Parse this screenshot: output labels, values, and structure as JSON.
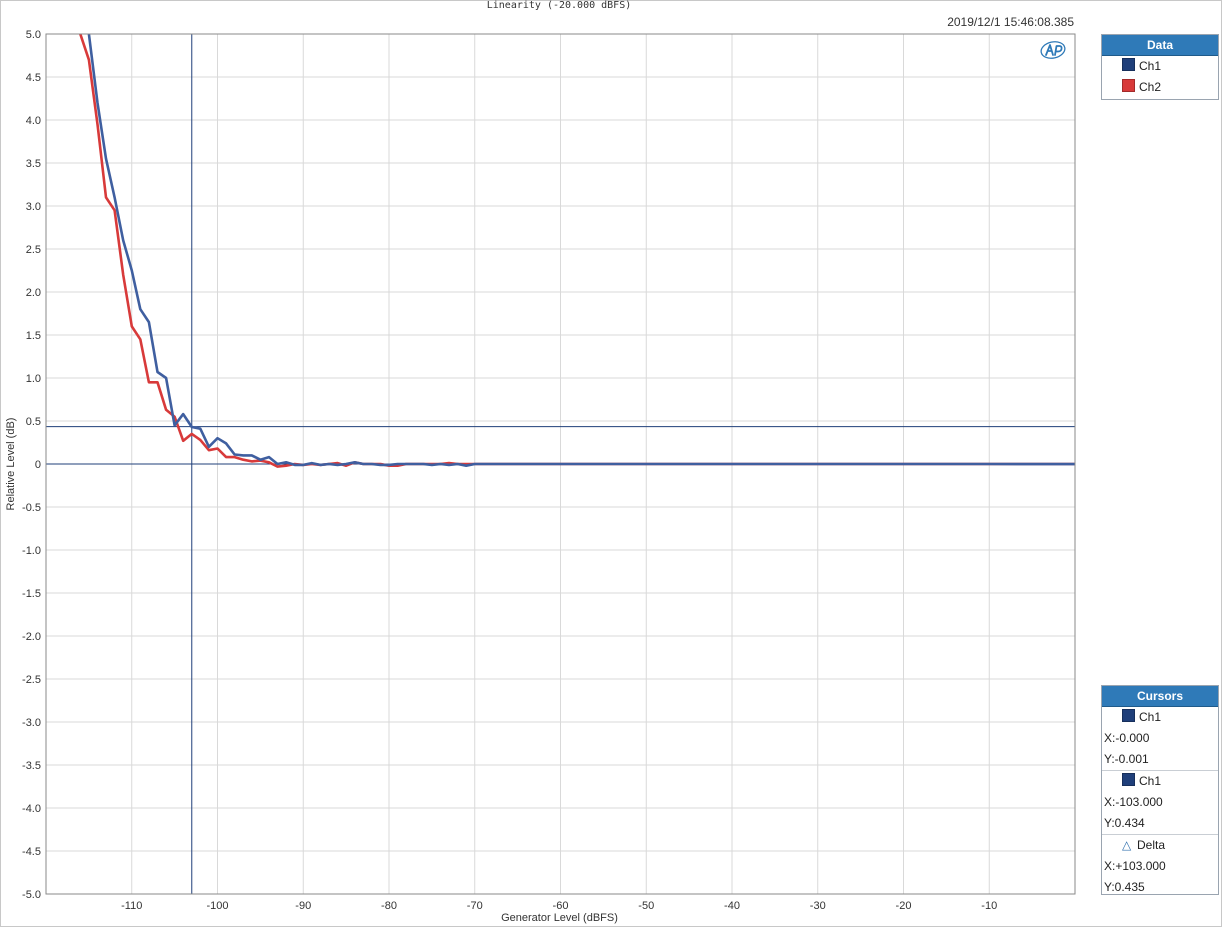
{
  "chart_data": {
    "type": "line",
    "title": "Linearity (-20.000 dBFS)",
    "timestamp": "2019/12/1 15:46:08.385",
    "xlabel": "Generator Level (dBFS)",
    "ylabel": "Relative Level (dB)",
    "xlim": [
      -120,
      0
    ],
    "ylim": [
      -5.0,
      5.0
    ],
    "x_ticks": [
      -110,
      -100,
      -90,
      -80,
      -70,
      -60,
      -50,
      -40,
      -30,
      -20,
      -10
    ],
    "x_tick_labels": [
      "-110",
      "-100",
      "-90",
      "-80",
      "-70",
      "-60",
      "-50",
      "-40",
      "-30",
      "-20",
      "-10"
    ],
    "y_ticks": [
      5.0,
      4.5,
      4.0,
      3.5,
      3.0,
      2.5,
      2.0,
      1.5,
      1.0,
      0.5,
      0,
      -0.5,
      -1.0,
      -1.5,
      -2.0,
      -2.5,
      -3.0,
      -3.5,
      -4.0,
      -4.5,
      -5.0
    ],
    "y_tick_labels": [
      "5.0",
      "4.5",
      "4.0",
      "3.5",
      "3.0",
      "2.5",
      "2.0",
      "1.5",
      "1.0",
      "0.5",
      "0",
      "-0.5",
      "-1.0",
      "-1.5",
      "-2.0",
      "-2.5",
      "-3.0",
      "-3.5",
      "-4.0",
      "-4.5",
      "-5.0"
    ],
    "grid": true,
    "legend_placement": "right",
    "series": [
      {
        "name": "Ch1",
        "color": "#3f5fa0",
        "x": [
          -115,
          -114,
          -113,
          -112,
          -111,
          -110,
          -109,
          -108,
          -107,
          -106,
          -105,
          -104,
          -103,
          -102,
          -101,
          -100,
          -99,
          -98,
          -97,
          -96,
          -95,
          -94,
          -93,
          -92,
          -91,
          -90,
          -89,
          -88,
          -87,
          -86,
          -85,
          -84,
          -83,
          -82,
          -81,
          -80,
          -79,
          -78,
          -77,
          -76,
          -75,
          -74,
          -73,
          -72,
          -71,
          -70,
          -60,
          -50,
          -40,
          -30,
          -20,
          -10,
          0
        ],
        "y": [
          5.0,
          4.2,
          3.55,
          3.1,
          2.6,
          2.25,
          1.8,
          1.65,
          1.07,
          1.0,
          0.45,
          0.58,
          0.43,
          0.41,
          0.2,
          0.3,
          0.24,
          0.11,
          0.1,
          0.1,
          0.05,
          0.08,
          0.0,
          0.02,
          -0.01,
          -0.01,
          0.01,
          -0.01,
          0.0,
          -0.01,
          0.0,
          0.02,
          0.0,
          0.0,
          -0.01,
          -0.01,
          0.0,
          0.0,
          0.0,
          0.0,
          -0.01,
          0.0,
          -0.01,
          0.0,
          -0.02,
          0.0,
          0.0,
          0.0,
          0.0,
          0.0,
          0.0,
          0.0,
          -0.001
        ]
      },
      {
        "name": "Ch2",
        "color": "#d83a3a",
        "x": [
          -116,
          -115,
          -114,
          -113,
          -112,
          -111,
          -110,
          -109,
          -108,
          -107,
          -106,
          -105,
          -104,
          -103,
          -102,
          -101,
          -100,
          -99,
          -98,
          -97,
          -96,
          -95,
          -94,
          -93,
          -92,
          -91,
          -90,
          -89,
          -88,
          -87,
          -86,
          -85,
          -84,
          -83,
          -82,
          -81,
          -80,
          -79,
          -78,
          -77,
          -76,
          -75,
          -74,
          -73,
          -72,
          -71,
          -70,
          -60,
          -50,
          -40,
          -30,
          -20,
          -10,
          0
        ],
        "y": [
          5.0,
          4.7,
          3.95,
          3.1,
          2.95,
          2.2,
          1.6,
          1.45,
          0.95,
          0.95,
          0.63,
          0.55,
          0.27,
          0.35,
          0.28,
          0.16,
          0.18,
          0.08,
          0.08,
          0.05,
          0.03,
          0.04,
          0.02,
          -0.03,
          -0.02,
          0.0,
          -0.01,
          0.0,
          -0.01,
          0.0,
          0.01,
          -0.02,
          0.02,
          0.0,
          0.0,
          0.0,
          -0.02,
          -0.02,
          0.0,
          0.0,
          0.0,
          0.0,
          0.0,
          0.01,
          0.0,
          0.0,
          0.0,
          0.0,
          0.0,
          0.0,
          0.0,
          0.0,
          0.0,
          0.0
        ]
      }
    ],
    "cursor_lines": [
      {
        "axis": "x",
        "value": -103.0
      },
      {
        "axis": "y",
        "value": 0.434
      },
      {
        "axis": "y",
        "value": 0.0
      }
    ]
  },
  "legend_panel": {
    "title": "Data",
    "items": [
      {
        "label": "Ch1",
        "color": "#1f3f7a"
      },
      {
        "label": "Ch2",
        "color": "#d83a3a"
      }
    ]
  },
  "cursors_panel": {
    "title": "Cursors",
    "blocks": [
      {
        "channel": "Ch1",
        "x": "X:-0.000",
        "y": "Y:-0.001"
      },
      {
        "channel": "Ch1",
        "x": "X:-103.000",
        "y": "Y:0.434"
      }
    ],
    "delta": {
      "label": "Delta",
      "x": "X:+103.000",
      "y": "Y:0.435"
    }
  },
  "logo_text": "AP"
}
